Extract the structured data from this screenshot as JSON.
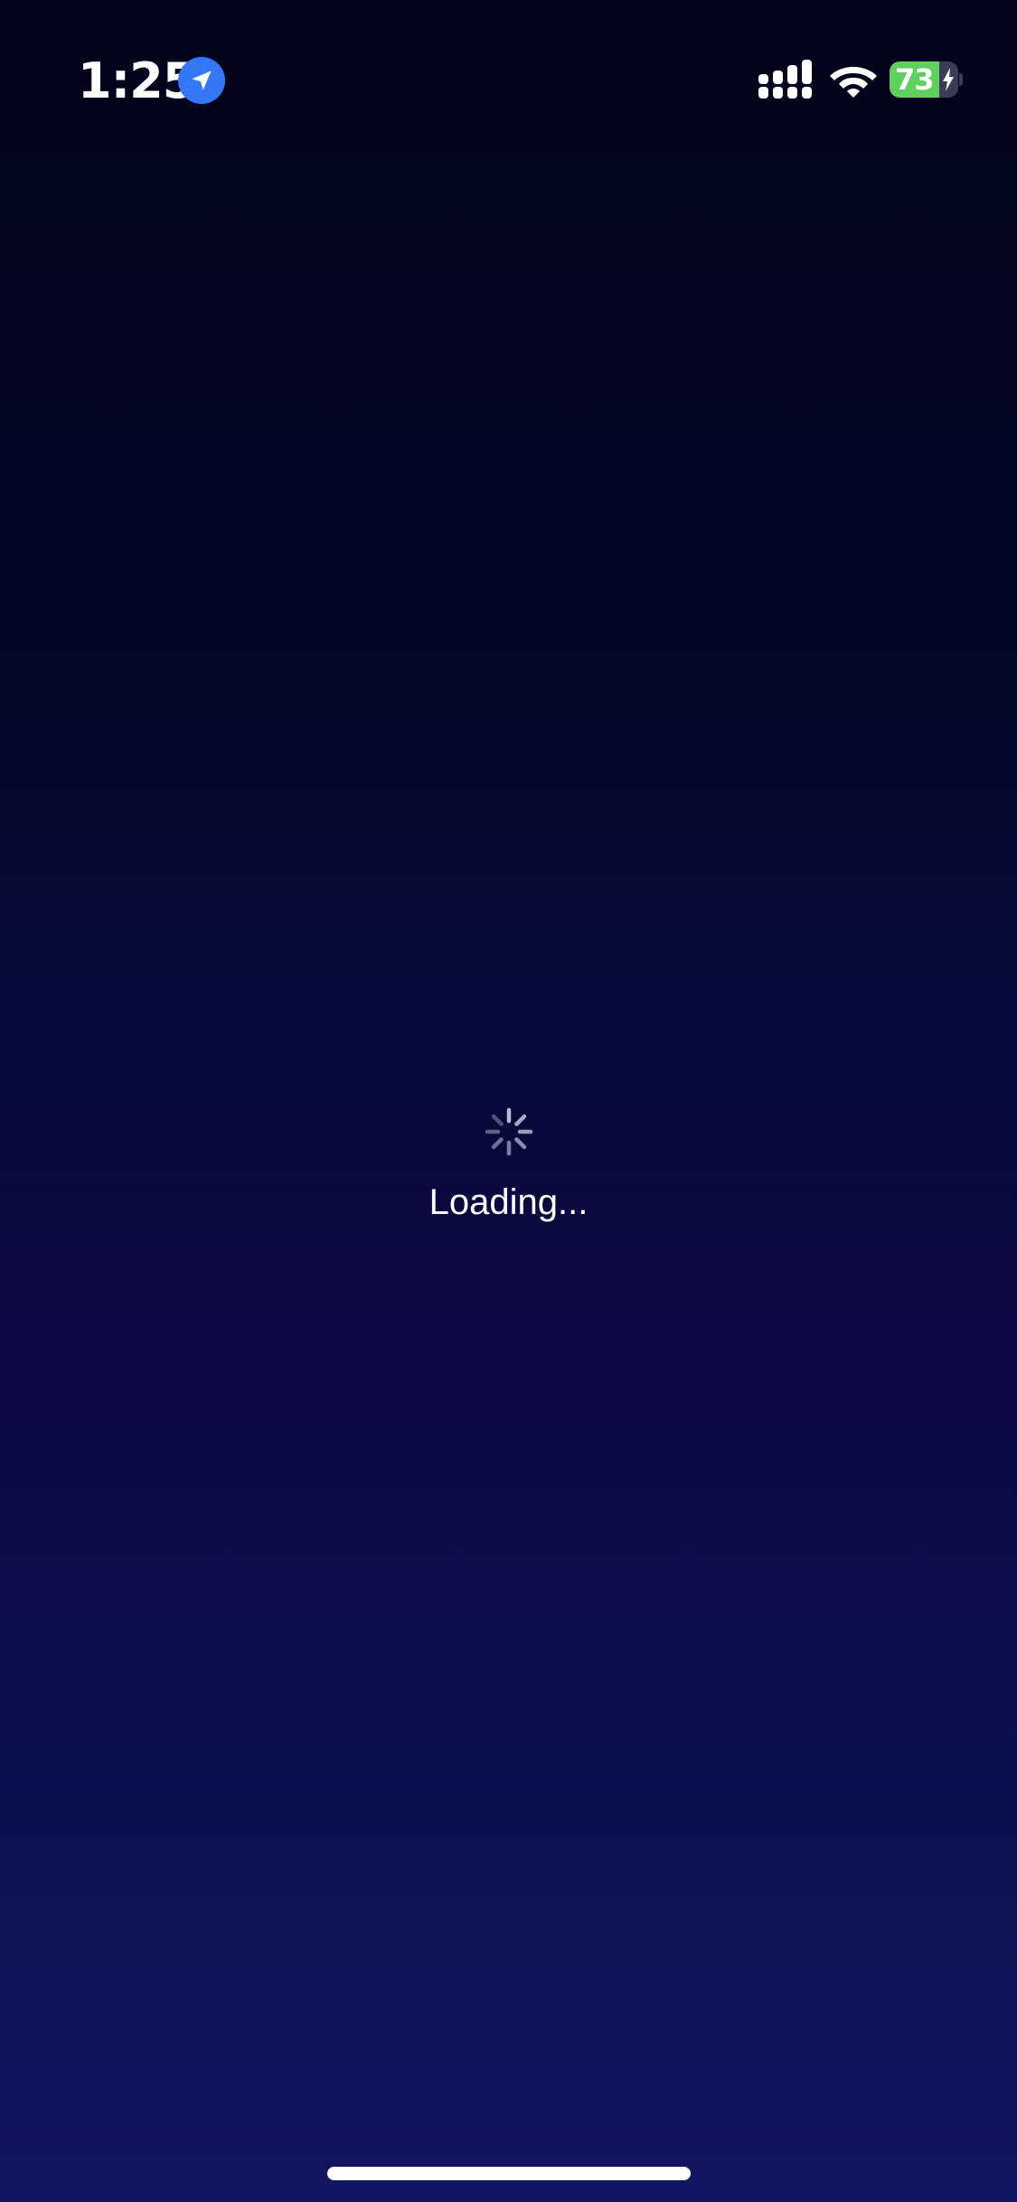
{
  "status_bar": {
    "time": "1:25",
    "location_icon": "location-arrow-icon",
    "location_color": "#3478f6",
    "signal_icon": "cellular-signal-icon",
    "wifi_icon": "wifi-icon",
    "battery": {
      "level": "73",
      "fraction": 0.73,
      "charging": true,
      "color": "#5fcf5f"
    }
  },
  "loader": {
    "icon": "spinner-icon",
    "text": "Loading..."
  },
  "home_indicator": {
    "icon": "home-indicator-bar"
  }
}
